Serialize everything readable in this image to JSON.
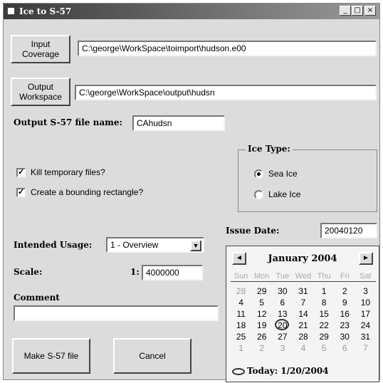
{
  "window": {
    "title": "Ice to S-57",
    "minimize": "_",
    "maximize": "□",
    "close": "×"
  },
  "input": {
    "button_line1": "Input",
    "button_line2": "Coverage",
    "value": "C:\\george\\WorkSpace\\toimport\\hudson.e00"
  },
  "output": {
    "button_line1": "Output",
    "button_line2": "Workspace",
    "value": "C:\\george\\WorkSpace\\output\\hudsn"
  },
  "s57_name": {
    "label": "Output S-57 file name:",
    "value": "CAhudsn"
  },
  "options": {
    "kill_temp": {
      "label": "Kill temporary files?",
      "checked": true
    },
    "bounding_rect": {
      "label": "Create a bounding rectangle?",
      "checked": true
    }
  },
  "ice_type": {
    "title": "Ice Type:",
    "options": [
      {
        "label": "Sea Ice",
        "selected": true
      },
      {
        "label": "Lake Ice",
        "selected": false
      }
    ]
  },
  "issue_date": {
    "label": "Issue Date:",
    "value": "20040120"
  },
  "usage": {
    "label": "Intended Usage:",
    "value": "1 - Overview"
  },
  "scale": {
    "label": "Scale:",
    "prefix": "1:",
    "value": "4000000"
  },
  "comment": {
    "label": "Comment",
    "value": ""
  },
  "buttons": {
    "make": "Make S-57 file",
    "cancel": "Cancel"
  },
  "calendar": {
    "month_label": "January 2004",
    "prev": "◄",
    "next": "►",
    "weekdays": [
      "Sun",
      "Mon",
      "Tue",
      "Wed",
      "Thu",
      "Fri",
      "Sat"
    ],
    "days": [
      {
        "d": "28",
        "other": true
      },
      {
        "d": "29",
        "other": false
      },
      {
        "d": "30",
        "other": false
      },
      {
        "d": "31",
        "other": false
      },
      {
        "d": "1",
        "other": false
      },
      {
        "d": "2",
        "other": false
      },
      {
        "d": "3",
        "other": false
      },
      {
        "d": "4",
        "other": false
      },
      {
        "d": "5",
        "other": false
      },
      {
        "d": "6",
        "other": false
      },
      {
        "d": "7",
        "other": false
      },
      {
        "d": "8",
        "other": false
      },
      {
        "d": "9",
        "other": false
      },
      {
        "d": "10",
        "other": false
      },
      {
        "d": "11",
        "other": false
      },
      {
        "d": "12",
        "other": false
      },
      {
        "d": "13",
        "other": false
      },
      {
        "d": "14",
        "other": false
      },
      {
        "d": "15",
        "other": false
      },
      {
        "d": "16",
        "other": false
      },
      {
        "d": "17",
        "other": false
      },
      {
        "d": "18",
        "other": false
      },
      {
        "d": "19",
        "other": false
      },
      {
        "d": "20",
        "other": false,
        "today": true
      },
      {
        "d": "21",
        "other": false
      },
      {
        "d": "22",
        "other": false
      },
      {
        "d": "23",
        "other": false
      },
      {
        "d": "24",
        "other": false
      },
      {
        "d": "25",
        "other": false
      },
      {
        "d": "26",
        "other": false
      },
      {
        "d": "27",
        "other": false
      },
      {
        "d": "28",
        "other": false
      },
      {
        "d": "29",
        "other": false
      },
      {
        "d": "30",
        "other": false
      },
      {
        "d": "31",
        "other": false
      },
      {
        "d": "1",
        "other": true
      },
      {
        "d": "2",
        "other": true
      },
      {
        "d": "3",
        "other": true
      },
      {
        "d": "4",
        "other": true
      },
      {
        "d": "5",
        "other": true
      },
      {
        "d": "6",
        "other": true
      },
      {
        "d": "7",
        "other": true
      }
    ],
    "today_label": "Today: 1/20/2004"
  }
}
